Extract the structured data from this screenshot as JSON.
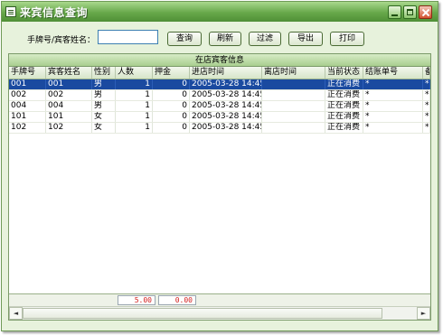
{
  "window": {
    "title": "来宾信息查询",
    "controls": {
      "minimize": "minimize",
      "maximize": "maximize",
      "close": "close"
    }
  },
  "search": {
    "label": "手牌号/宾客姓名：",
    "value": "",
    "placeholder": ""
  },
  "toolbar": {
    "buttons": [
      {
        "label": "查询"
      },
      {
        "label": "刷新"
      },
      {
        "label": "过滤"
      },
      {
        "label": "导出"
      },
      {
        "label": "打印"
      }
    ]
  },
  "grid": {
    "caption": "在店宾客信息",
    "columns": [
      "手牌号",
      "宾客姓名",
      "性别",
      "人数",
      "押金",
      "进店时间",
      "离店时间",
      "当前状态",
      "结账单号",
      "备"
    ],
    "rows": [
      [
        "001",
        "001",
        "男",
        "1",
        "0",
        "2005-03-28 14:45:",
        "",
        "正在消费",
        "*",
        "*"
      ],
      [
        "002",
        "002",
        "男",
        "1",
        "0",
        "2005-03-28 14:45:",
        "",
        "正在消费",
        "*",
        "*"
      ],
      [
        "004",
        "004",
        "男",
        "1",
        "0",
        "2005-03-28 14:45:",
        "",
        "正在消费",
        "*",
        "*"
      ],
      [
        "101",
        "101",
        "女",
        "1",
        "0",
        "2005-03-28 14:45:",
        "",
        "正在消费",
        "*",
        "*"
      ],
      [
        "102",
        "102",
        "女",
        "1",
        "0",
        "2005-03-28 14:45:",
        "",
        "正在消费",
        "*",
        "*"
      ]
    ],
    "selected_row": 0,
    "totals": {
      "people": "5.00",
      "deposit": "0.00"
    }
  },
  "colors": {
    "titlebar": "#67a84a",
    "window_bg": "#e7f2dc",
    "selection": "#1a4aa0",
    "totals_text": "#d21d1d"
  },
  "icons": {
    "scroll_left": "◄",
    "scroll_right": "►"
  }
}
